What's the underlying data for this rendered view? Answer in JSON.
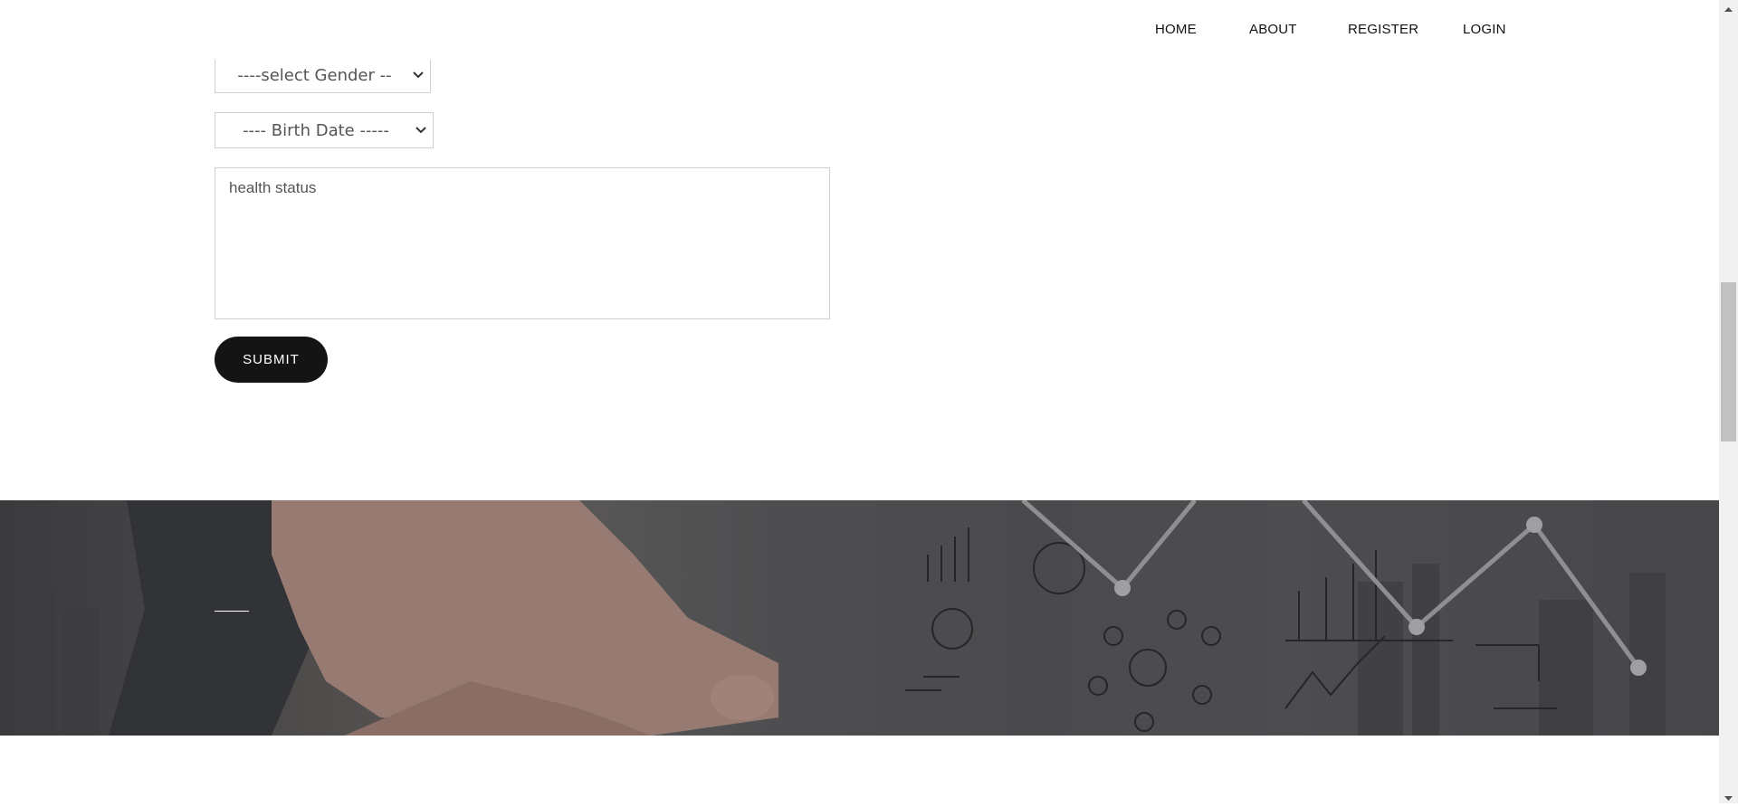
{
  "nav": {
    "items": [
      {
        "label": "HOME"
      },
      {
        "label": "ABOUT"
      },
      {
        "label": "REGISTER"
      },
      {
        "label": "LOGIN"
      }
    ]
  },
  "form": {
    "gender_select": {
      "value": "----select Gender --"
    },
    "birthdate_select": {
      "value": "---- Birth Date -----"
    },
    "health_status": {
      "placeholder": "health status"
    },
    "submit_label": "SUBMIT"
  },
  "icons": {
    "select_chevron": "chevron-down-icon",
    "scroll_up": "scroll-up-arrow-icon",
    "scroll_down": "scroll-down-arrow-icon"
  },
  "colors": {
    "button_bg": "#141414",
    "banner_overlay": "#4f4f52"
  }
}
